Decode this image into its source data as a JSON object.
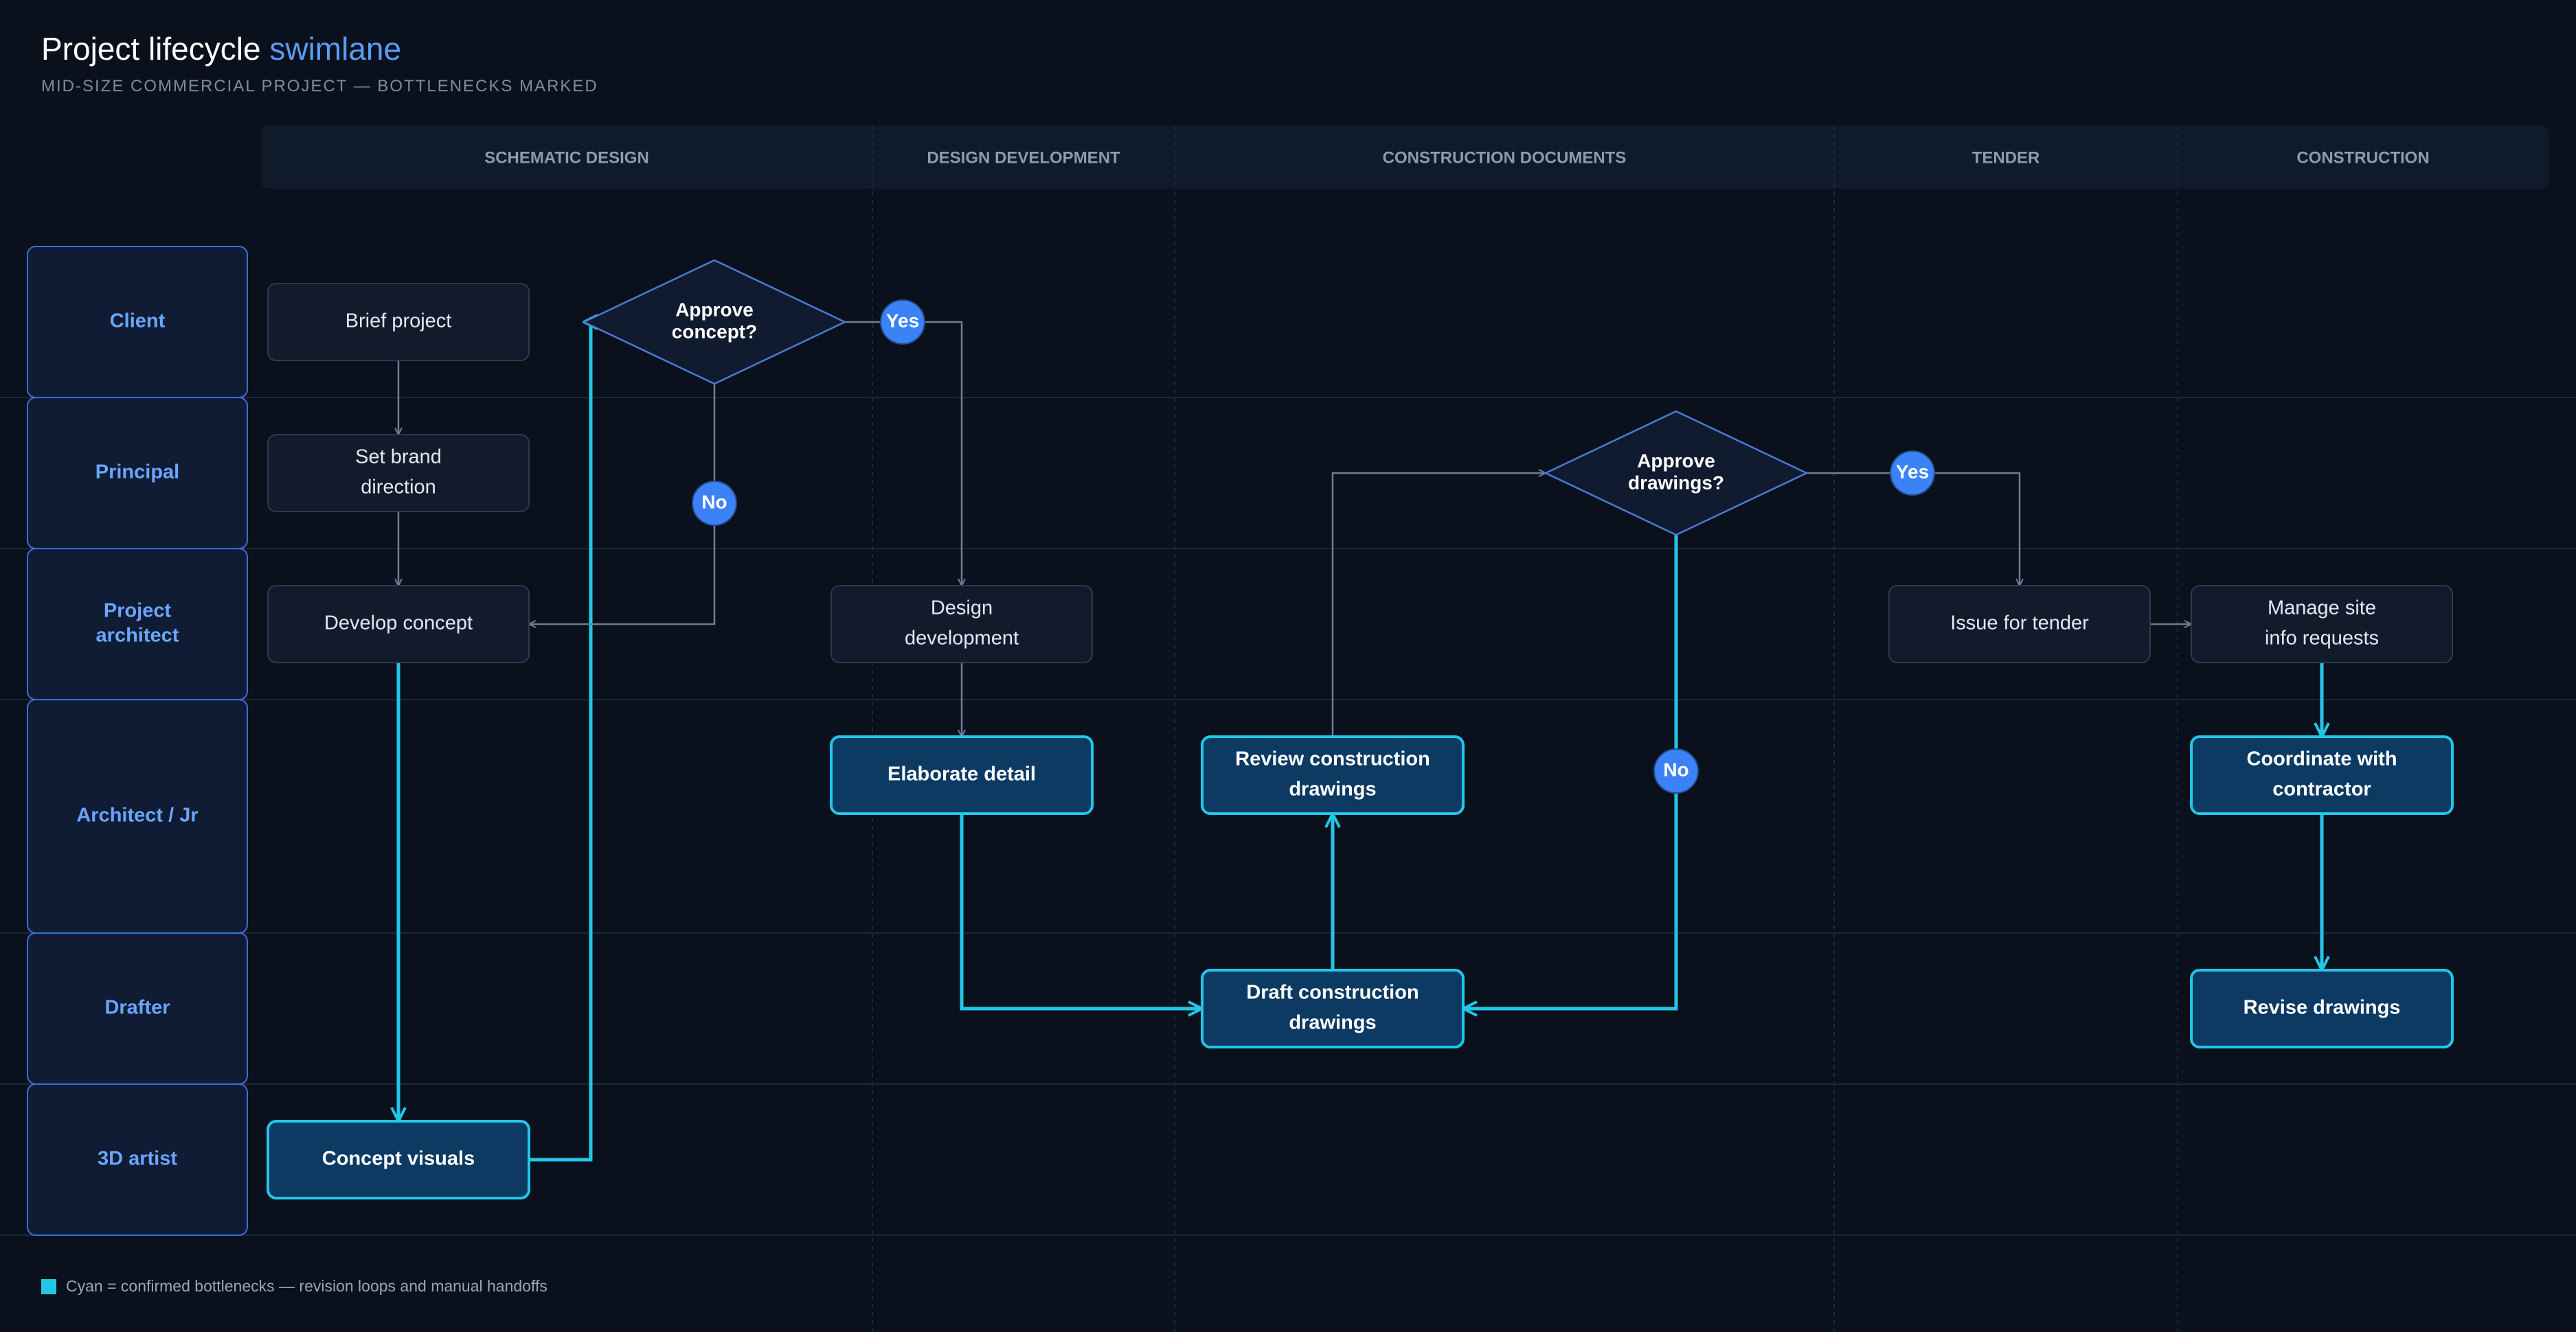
{
  "header": {
    "title_main": "Project lifecycle",
    "title_accent": "swimlane",
    "subtitle": "MID-SIZE COMMERCIAL PROJECT — BOTTLENECKS MARKED"
  },
  "phases": [
    "SCHEMATIC DESIGN",
    "DESIGN DEVELOPMENT",
    "CONSTRUCTION DOCUMENTS",
    "TENDER",
    "CONSTRUCTION"
  ],
  "lanes": [
    {
      "id": "client",
      "lines": [
        "Client"
      ]
    },
    {
      "id": "principal",
      "lines": [
        "Principal"
      ]
    },
    {
      "id": "project-architect",
      "lines": [
        "Project",
        "architect"
      ]
    },
    {
      "id": "architect-jr",
      "lines": [
        "Architect / Jr"
      ]
    },
    {
      "id": "drafter",
      "lines": [
        "Drafter"
      ]
    },
    {
      "id": "3d-artist",
      "lines": [
        "3D artist"
      ]
    }
  ],
  "nodes": [
    {
      "id": "brief-project",
      "kind": "process",
      "lines": [
        "Brief project"
      ]
    },
    {
      "id": "set-brand-direction",
      "kind": "process",
      "lines": [
        "Set brand",
        "direction"
      ]
    },
    {
      "id": "develop-concept",
      "kind": "process",
      "lines": [
        "Develop concept"
      ]
    },
    {
      "id": "concept-visuals",
      "kind": "bottleneck",
      "lines": [
        "Concept visuals"
      ]
    },
    {
      "id": "approve-concept",
      "kind": "decision",
      "lines": [
        "Approve",
        "concept?"
      ]
    },
    {
      "id": "design-development",
      "kind": "process",
      "lines": [
        "Design",
        "development"
      ]
    },
    {
      "id": "elaborate-detail",
      "kind": "bottleneck",
      "lines": [
        "Elaborate detail"
      ]
    },
    {
      "id": "review-construction-drawings",
      "kind": "bottleneck",
      "lines": [
        "Review construction",
        "drawings"
      ]
    },
    {
      "id": "draft-construction-drawings",
      "kind": "bottleneck",
      "lines": [
        "Draft construction",
        "drawings"
      ]
    },
    {
      "id": "approve-drawings",
      "kind": "decision",
      "lines": [
        "Approve",
        "drawings?"
      ]
    },
    {
      "id": "issue-for-tender",
      "kind": "process",
      "lines": [
        "Issue for tender"
      ]
    },
    {
      "id": "manage-site-info-requests",
      "kind": "process",
      "lines": [
        "Manage site",
        "info requests"
      ]
    },
    {
      "id": "coordinate-with-contractor",
      "kind": "bottleneck",
      "lines": [
        "Coordinate with",
        "contractor"
      ]
    },
    {
      "id": "revise-drawings",
      "kind": "bottleneck",
      "lines": [
        "Revise drawings"
      ]
    }
  ],
  "badges": [
    {
      "id": "concept-yes",
      "text": "Yes"
    },
    {
      "id": "concept-no",
      "text": "No"
    },
    {
      "id": "drawings-yes",
      "text": "Yes"
    },
    {
      "id": "drawings-no",
      "text": "No"
    }
  ],
  "edges": [
    {
      "from": "brief-project",
      "to": "set-brand-direction",
      "style": "normal"
    },
    {
      "from": "set-brand-direction",
      "to": "develop-concept",
      "style": "normal"
    },
    {
      "from": "develop-concept",
      "to": "concept-visuals",
      "style": "bottleneck"
    },
    {
      "from": "concept-visuals",
      "to": "approve-concept",
      "style": "bottleneck"
    },
    {
      "from": "approve-concept",
      "to": "design-development",
      "style": "normal",
      "label": "Yes"
    },
    {
      "from": "approve-concept",
      "to": "develop-concept",
      "style": "normal",
      "label": "No"
    },
    {
      "from": "design-development",
      "to": "elaborate-detail",
      "style": "normal"
    },
    {
      "from": "elaborate-detail",
      "to": "draft-construction-drawings",
      "style": "bottleneck"
    },
    {
      "from": "draft-construction-drawings",
      "to": "review-construction-drawings",
      "style": "bottleneck"
    },
    {
      "from": "review-construction-drawings",
      "to": "approve-drawings",
      "style": "normal"
    },
    {
      "from": "approve-drawings",
      "to": "issue-for-tender",
      "style": "normal",
      "label": "Yes"
    },
    {
      "from": "approve-drawings",
      "to": "draft-construction-drawings",
      "style": "bottleneck",
      "label": "No"
    },
    {
      "from": "issue-for-tender",
      "to": "manage-site-info-requests",
      "style": "normal"
    },
    {
      "from": "manage-site-info-requests",
      "to": "coordinate-with-contractor",
      "style": "bottleneck"
    },
    {
      "from": "coordinate-with-contractor",
      "to": "revise-drawings",
      "style": "bottleneck"
    }
  ],
  "legend": {
    "text": "Cyan = confirmed bottlenecks — revision loops and manual handoffs"
  },
  "colors": {
    "background": "#0a111c",
    "accent": "#5b9cf6",
    "bottleneck": "#22c7e8",
    "bottleneck_fill": "#0d3a63",
    "process_fill": "#111b2c",
    "badge": "#3b82f6"
  }
}
